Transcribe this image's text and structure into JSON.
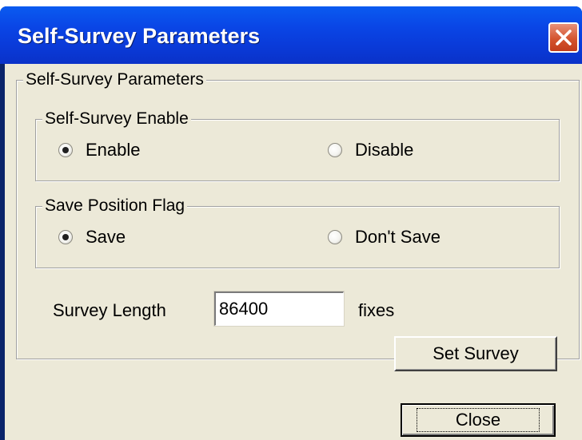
{
  "window": {
    "title": "Self-Survey Parameters",
    "close_icon": "close-x-icon"
  },
  "main_group": {
    "label": "Self-Survey Parameters",
    "enable_group": {
      "label": "Self-Survey Enable",
      "options": [
        {
          "label": "Enable",
          "checked": true
        },
        {
          "label": "Disable",
          "checked": false
        }
      ]
    },
    "save_group": {
      "label": "Save Position Flag",
      "options": [
        {
          "label": "Save",
          "checked": true
        },
        {
          "label": "Don't Save",
          "checked": false
        }
      ]
    },
    "survey_length": {
      "label": "Survey Length",
      "value": "86400",
      "unit": "fixes"
    },
    "set_survey_label": "Set Survey"
  },
  "footer": {
    "close_label": "Close"
  },
  "colors": {
    "title_blue": "#0a46e6",
    "dialog_face": "#ece9d8",
    "close_red": "#d4542f"
  }
}
